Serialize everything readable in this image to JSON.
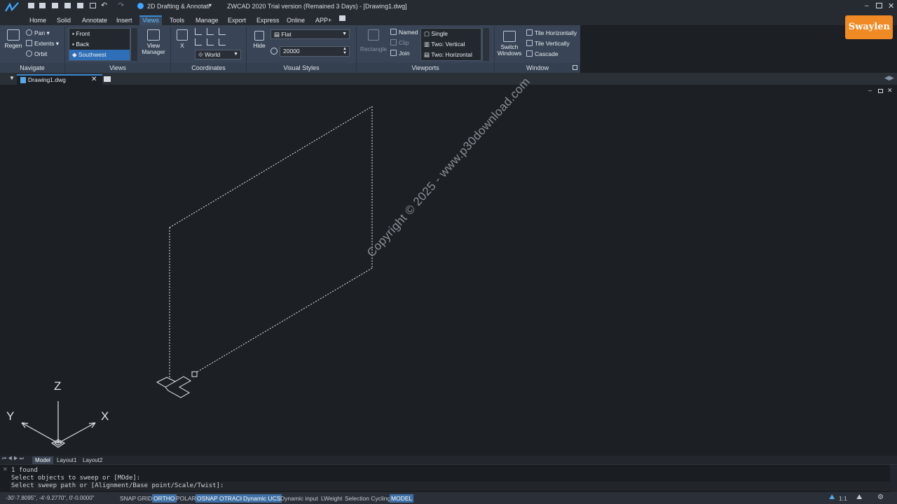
{
  "title": {
    "workspace": "2D Drafting & Annotati",
    "window_title": "ZWCAD 2020 Trial version (Remained 3 Days) - [Drawing1.dwg]"
  },
  "tabs": [
    "Home",
    "Solid",
    "Annotate",
    "Insert",
    "Views",
    "Tools",
    "Manage",
    "Export",
    "Express",
    "Online",
    "APP+"
  ],
  "ribbon": {
    "navigate": {
      "title": "Navigate",
      "regen": "Regen",
      "pan": "Pan",
      "extents": "Extents",
      "orbit": "Orbit"
    },
    "views": {
      "title": "Views",
      "items": [
        "Front",
        "Back",
        "Southwest"
      ],
      "view_manager": "View Manager"
    },
    "coordinates": {
      "title": "Coordinates",
      "x": "X",
      "world": "World"
    },
    "visual_styles": {
      "title": "Visual Styles",
      "style": "Flat",
      "hide": "Hide",
      "value": "20000"
    },
    "viewports": {
      "title": "Viewports",
      "rectangle": "Rectangle",
      "named": "Named",
      "clip": "Clip",
      "join": "Join",
      "single": "Single",
      "two_v": "Two: Vertical",
      "two_h": "Two: Horizontal"
    },
    "window": {
      "title": "Window",
      "switch": "Switch Windows",
      "tile_h": "Tile Horizontally",
      "tile_v": "Tile Vertically",
      "cascade": "Cascade"
    }
  },
  "document_tab": "Drawing1.dwg",
  "layout_tabs": [
    "Model",
    "Layout1",
    "Layout2"
  ],
  "ucs": {
    "x": "X",
    "y": "Y",
    "z": "Z"
  },
  "watermark": "Copyright © 2025 - www.p30download.com",
  "brand": "Swaylen",
  "command": [
    "1 found",
    "Select objects to sweep or [MOde]:",
    "Select sweep path or [Alignment/Base point/Scale/Twist]:"
  ],
  "status": {
    "coords": "-30'-7.8095\", -4'-9.2770\", 0'-0.0000\"",
    "toggles": [
      "SNAP",
      "GRID",
      "ORTHO",
      "POLAR",
      "OSNAP",
      "OTRACK",
      "Dynamic UCS",
      "Dynamic input",
      "LWeight",
      "Selection Cycling",
      "MODEL"
    ],
    "active": [
      "ORTHO",
      "OSNAP",
      "OTRACK",
      "Dynamic UCS",
      "MODEL"
    ],
    "scale": "1:1"
  }
}
